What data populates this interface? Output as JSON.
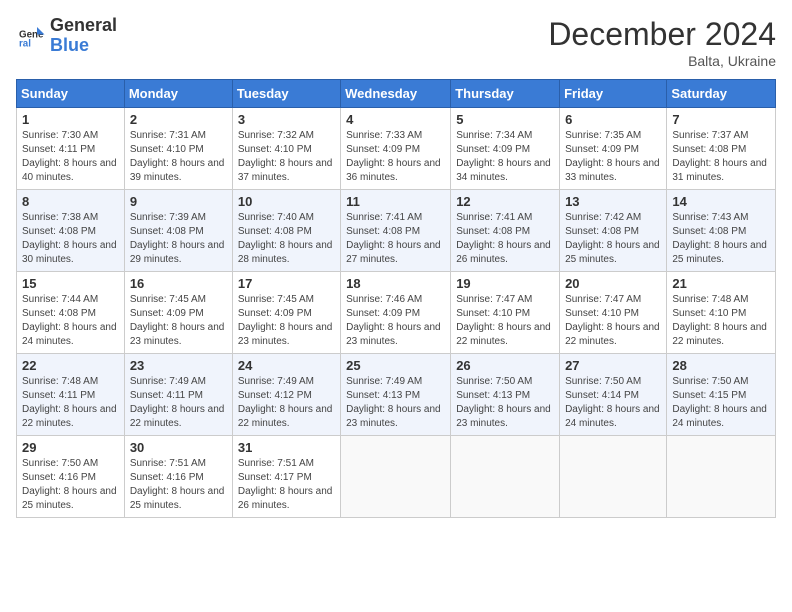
{
  "logo": {
    "general": "General",
    "blue": "Blue"
  },
  "title": "December 2024",
  "location": "Balta, Ukraine",
  "weekdays": [
    "Sunday",
    "Monday",
    "Tuesday",
    "Wednesday",
    "Thursday",
    "Friday",
    "Saturday"
  ],
  "weeks": [
    [
      {
        "day": "1",
        "sunrise": "Sunrise: 7:30 AM",
        "sunset": "Sunset: 4:11 PM",
        "daylight": "Daylight: 8 hours and 40 minutes."
      },
      {
        "day": "2",
        "sunrise": "Sunrise: 7:31 AM",
        "sunset": "Sunset: 4:10 PM",
        "daylight": "Daylight: 8 hours and 39 minutes."
      },
      {
        "day": "3",
        "sunrise": "Sunrise: 7:32 AM",
        "sunset": "Sunset: 4:10 PM",
        "daylight": "Daylight: 8 hours and 37 minutes."
      },
      {
        "day": "4",
        "sunrise": "Sunrise: 7:33 AM",
        "sunset": "Sunset: 4:09 PM",
        "daylight": "Daylight: 8 hours and 36 minutes."
      },
      {
        "day": "5",
        "sunrise": "Sunrise: 7:34 AM",
        "sunset": "Sunset: 4:09 PM",
        "daylight": "Daylight: 8 hours and 34 minutes."
      },
      {
        "day": "6",
        "sunrise": "Sunrise: 7:35 AM",
        "sunset": "Sunset: 4:09 PM",
        "daylight": "Daylight: 8 hours and 33 minutes."
      },
      {
        "day": "7",
        "sunrise": "Sunrise: 7:37 AM",
        "sunset": "Sunset: 4:08 PM",
        "daylight": "Daylight: 8 hours and 31 minutes."
      }
    ],
    [
      {
        "day": "8",
        "sunrise": "Sunrise: 7:38 AM",
        "sunset": "Sunset: 4:08 PM",
        "daylight": "Daylight: 8 hours and 30 minutes."
      },
      {
        "day": "9",
        "sunrise": "Sunrise: 7:39 AM",
        "sunset": "Sunset: 4:08 PM",
        "daylight": "Daylight: 8 hours and 29 minutes."
      },
      {
        "day": "10",
        "sunrise": "Sunrise: 7:40 AM",
        "sunset": "Sunset: 4:08 PM",
        "daylight": "Daylight: 8 hours and 28 minutes."
      },
      {
        "day": "11",
        "sunrise": "Sunrise: 7:41 AM",
        "sunset": "Sunset: 4:08 PM",
        "daylight": "Daylight: 8 hours and 27 minutes."
      },
      {
        "day": "12",
        "sunrise": "Sunrise: 7:41 AM",
        "sunset": "Sunset: 4:08 PM",
        "daylight": "Daylight: 8 hours and 26 minutes."
      },
      {
        "day": "13",
        "sunrise": "Sunrise: 7:42 AM",
        "sunset": "Sunset: 4:08 PM",
        "daylight": "Daylight: 8 hours and 25 minutes."
      },
      {
        "day": "14",
        "sunrise": "Sunrise: 7:43 AM",
        "sunset": "Sunset: 4:08 PM",
        "daylight": "Daylight: 8 hours and 25 minutes."
      }
    ],
    [
      {
        "day": "15",
        "sunrise": "Sunrise: 7:44 AM",
        "sunset": "Sunset: 4:08 PM",
        "daylight": "Daylight: 8 hours and 24 minutes."
      },
      {
        "day": "16",
        "sunrise": "Sunrise: 7:45 AM",
        "sunset": "Sunset: 4:09 PM",
        "daylight": "Daylight: 8 hours and 23 minutes."
      },
      {
        "day": "17",
        "sunrise": "Sunrise: 7:45 AM",
        "sunset": "Sunset: 4:09 PM",
        "daylight": "Daylight: 8 hours and 23 minutes."
      },
      {
        "day": "18",
        "sunrise": "Sunrise: 7:46 AM",
        "sunset": "Sunset: 4:09 PM",
        "daylight": "Daylight: 8 hours and 23 minutes."
      },
      {
        "day": "19",
        "sunrise": "Sunrise: 7:47 AM",
        "sunset": "Sunset: 4:10 PM",
        "daylight": "Daylight: 8 hours and 22 minutes."
      },
      {
        "day": "20",
        "sunrise": "Sunrise: 7:47 AM",
        "sunset": "Sunset: 4:10 PM",
        "daylight": "Daylight: 8 hours and 22 minutes."
      },
      {
        "day": "21",
        "sunrise": "Sunrise: 7:48 AM",
        "sunset": "Sunset: 4:10 PM",
        "daylight": "Daylight: 8 hours and 22 minutes."
      }
    ],
    [
      {
        "day": "22",
        "sunrise": "Sunrise: 7:48 AM",
        "sunset": "Sunset: 4:11 PM",
        "daylight": "Daylight: 8 hours and 22 minutes."
      },
      {
        "day": "23",
        "sunrise": "Sunrise: 7:49 AM",
        "sunset": "Sunset: 4:11 PM",
        "daylight": "Daylight: 8 hours and 22 minutes."
      },
      {
        "day": "24",
        "sunrise": "Sunrise: 7:49 AM",
        "sunset": "Sunset: 4:12 PM",
        "daylight": "Daylight: 8 hours and 22 minutes."
      },
      {
        "day": "25",
        "sunrise": "Sunrise: 7:49 AM",
        "sunset": "Sunset: 4:13 PM",
        "daylight": "Daylight: 8 hours and 23 minutes."
      },
      {
        "day": "26",
        "sunrise": "Sunrise: 7:50 AM",
        "sunset": "Sunset: 4:13 PM",
        "daylight": "Daylight: 8 hours and 23 minutes."
      },
      {
        "day": "27",
        "sunrise": "Sunrise: 7:50 AM",
        "sunset": "Sunset: 4:14 PM",
        "daylight": "Daylight: 8 hours and 24 minutes."
      },
      {
        "day": "28",
        "sunrise": "Sunrise: 7:50 AM",
        "sunset": "Sunset: 4:15 PM",
        "daylight": "Daylight: 8 hours and 24 minutes."
      }
    ],
    [
      {
        "day": "29",
        "sunrise": "Sunrise: 7:50 AM",
        "sunset": "Sunset: 4:16 PM",
        "daylight": "Daylight: 8 hours and 25 minutes."
      },
      {
        "day": "30",
        "sunrise": "Sunrise: 7:51 AM",
        "sunset": "Sunset: 4:16 PM",
        "daylight": "Daylight: 8 hours and 25 minutes."
      },
      {
        "day": "31",
        "sunrise": "Sunrise: 7:51 AM",
        "sunset": "Sunset: 4:17 PM",
        "daylight": "Daylight: 8 hours and 26 minutes."
      },
      null,
      null,
      null,
      null
    ]
  ]
}
